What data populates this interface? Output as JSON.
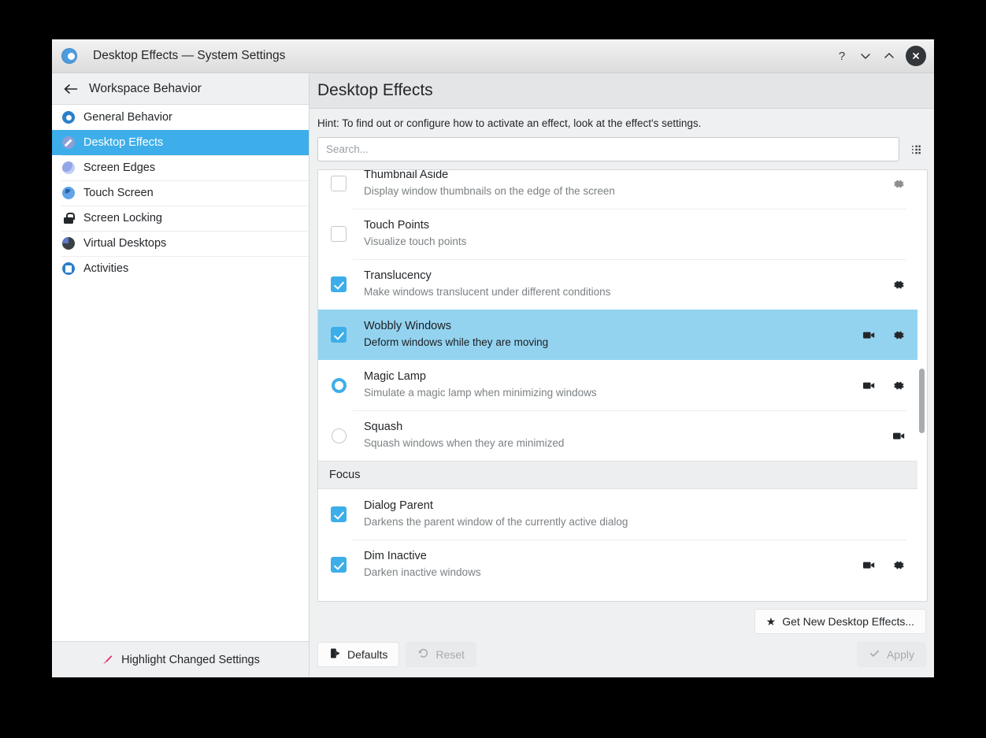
{
  "window": {
    "title": "Desktop Effects — System Settings",
    "app_icon": "system-settings-icon",
    "controls": {
      "help": "?",
      "minimize": "minimize-icon",
      "maximize": "maximize-icon",
      "close": "close-icon"
    }
  },
  "sidebar": {
    "back_label": "Workspace Behavior",
    "items": [
      {
        "label": "General Behavior",
        "icon": "general-behavior-icon",
        "selected": false
      },
      {
        "label": "Desktop Effects",
        "icon": "desktop-effects-icon",
        "selected": true
      },
      {
        "label": "Screen Edges",
        "icon": "screen-edges-icon",
        "selected": false
      },
      {
        "label": "Touch Screen",
        "icon": "touch-screen-icon",
        "selected": false
      },
      {
        "label": "Screen Locking",
        "icon": "screen-locking-icon",
        "selected": false
      },
      {
        "label": "Virtual Desktops",
        "icon": "virtual-desktops-icon",
        "selected": false
      },
      {
        "label": "Activities",
        "icon": "activities-icon",
        "selected": false
      }
    ],
    "footer": {
      "highlight_label": "Highlight Changed Settings",
      "highlight_icon": "brush-icon"
    }
  },
  "main": {
    "title": "Desktop Effects",
    "hint": "Hint: To find out or configure how to activate an effect, look at the effect's settings.",
    "search": {
      "value": "",
      "placeholder": "Search..."
    },
    "configure_icon": "grid-dots-icon",
    "effects": [
      {
        "name": "Thumbnail Aside",
        "description": "Display window thumbnails on the edge of the screen",
        "control": "checkbox",
        "checked": false,
        "selected": false,
        "has_video": false,
        "has_settings": true
      },
      {
        "name": "Touch Points",
        "description": "Visualize touch points",
        "control": "checkbox",
        "checked": false,
        "selected": false,
        "has_video": false,
        "has_settings": false
      },
      {
        "name": "Translucency",
        "description": "Make windows translucent under different conditions",
        "control": "checkbox",
        "checked": true,
        "selected": false,
        "has_video": false,
        "has_settings": true
      },
      {
        "name": "Wobbly Windows",
        "description": "Deform windows while they are moving",
        "control": "checkbox",
        "checked": true,
        "selected": true,
        "has_video": true,
        "has_settings": true
      },
      {
        "name": "Magic Lamp",
        "description": "Simulate a magic lamp when minimizing windows",
        "control": "radio",
        "checked": true,
        "selected": false,
        "has_video": true,
        "has_settings": true
      },
      {
        "name": "Squash",
        "description": "Squash windows when they are minimized",
        "control": "radio",
        "checked": false,
        "selected": false,
        "has_video": true,
        "has_settings": false
      }
    ],
    "group_focus": {
      "title": "Focus",
      "effects": [
        {
          "name": "Dialog Parent",
          "description": "Darkens the parent window of the currently active dialog",
          "control": "checkbox",
          "checked": true,
          "selected": false,
          "has_video": false,
          "has_settings": false
        },
        {
          "name": "Dim Inactive",
          "description": "Darken inactive windows",
          "control": "checkbox",
          "checked": true,
          "selected": false,
          "has_video": true,
          "has_settings": true
        }
      ]
    },
    "get_new_button": {
      "label": "Get New Desktop Effects...",
      "icon": "star-icon"
    },
    "actions": {
      "defaults": {
        "label": "Defaults",
        "icon": "defaults-icon",
        "enabled": true
      },
      "reset": {
        "label": "Reset",
        "icon": "undo-icon",
        "enabled": false
      },
      "apply": {
        "label": "Apply",
        "icon": "check-icon",
        "enabled": false
      }
    }
  },
  "colors": {
    "accent": "#3daee9",
    "selection_row": "#94d3f0",
    "window_bg": "#eff0f1",
    "text": "#232629",
    "muted_text": "#7c8184",
    "brush_accent": "#e6176b"
  }
}
